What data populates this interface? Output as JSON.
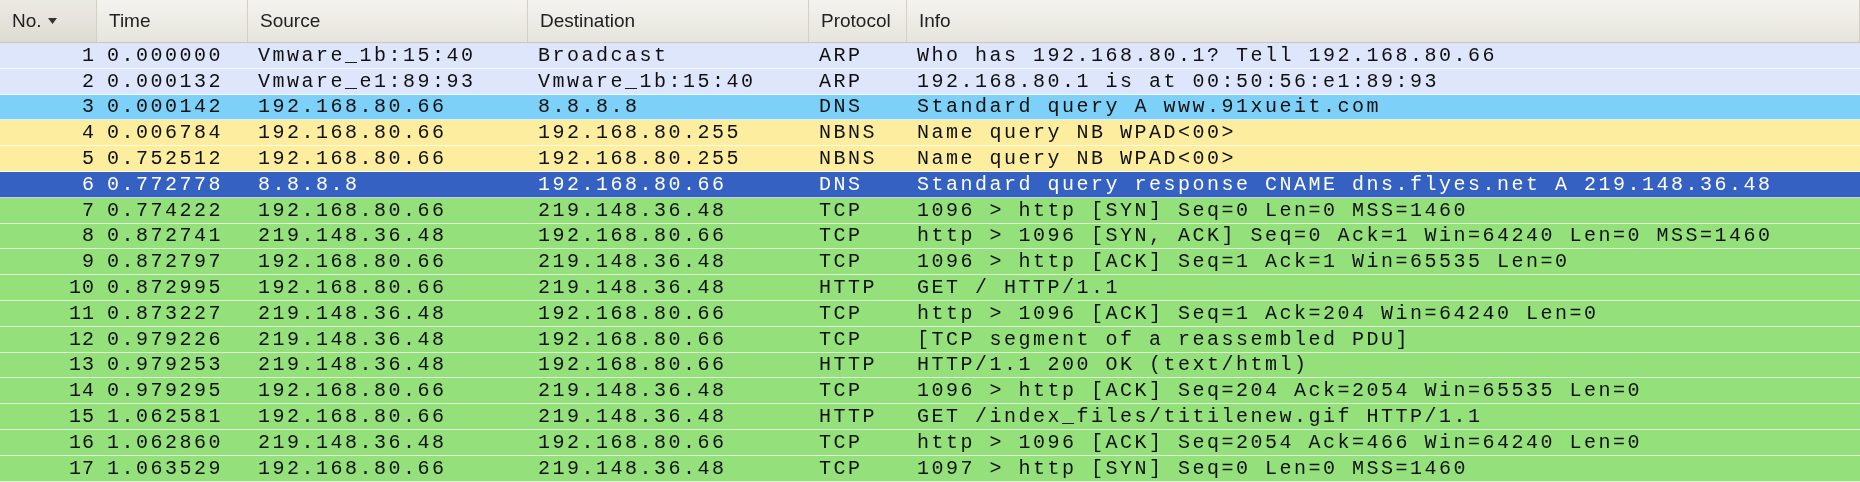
{
  "table": {
    "columns": [
      {
        "label": "No.",
        "sorted": true
      },
      {
        "label": "Time",
        "sorted": false
      },
      {
        "label": "Source",
        "sorted": false
      },
      {
        "label": "Destination",
        "sorted": false
      },
      {
        "label": "Protocol",
        "sorted": false
      },
      {
        "label": "Info",
        "sorted": false
      }
    ],
    "rows": [
      {
        "no": "1",
        "time": "0.000000",
        "source": "Vmware_1b:15:40",
        "destination": "Broadcast",
        "protocol": "ARP",
        "info": "Who has 192.168.80.1?  Tell 192.168.80.66",
        "color": "#dde6fb",
        "selected": false
      },
      {
        "no": "2",
        "time": "0.000132",
        "source": "Vmware_e1:89:93",
        "destination": "Vmware_1b:15:40",
        "protocol": "ARP",
        "info": "192.168.80.1 is at 00:50:56:e1:89:93",
        "color": "#dde6fb",
        "selected": false
      },
      {
        "no": "3",
        "time": "0.000142",
        "source": "192.168.80.66",
        "destination": "8.8.8.8",
        "protocol": "DNS",
        "info": "Standard query A www.91xueit.com",
        "color": "#7dd0f7",
        "selected": false
      },
      {
        "no": "4",
        "time": "0.006784",
        "source": "192.168.80.66",
        "destination": "192.168.80.255",
        "protocol": "NBNS",
        "info": "Name query NB WPAD<00>",
        "color": "#fdee9f",
        "selected": false
      },
      {
        "no": "5",
        "time": "0.752512",
        "source": "192.168.80.66",
        "destination": "192.168.80.255",
        "protocol": "NBNS",
        "info": "Name query NB WPAD<00>",
        "color": "#fdee9f",
        "selected": false
      },
      {
        "no": "6",
        "time": "0.772778",
        "source": "8.8.8.8",
        "destination": "192.168.80.66",
        "protocol": "DNS",
        "info": "Standard query response CNAME dns.flyes.net A 219.148.36.48",
        "selected": true
      },
      {
        "no": "7",
        "time": "0.774222",
        "source": "192.168.80.66",
        "destination": "219.148.36.48",
        "protocol": "TCP",
        "info": "1096 > http [SYN] Seq=0 Len=0 MSS=1460",
        "color": "#94e07a",
        "selected": false
      },
      {
        "no": "8",
        "time": "0.872741",
        "source": "219.148.36.48",
        "destination": "192.168.80.66",
        "protocol": "TCP",
        "info": "http > 1096 [SYN, ACK] Seq=0 Ack=1 Win=64240 Len=0 MSS=1460",
        "color": "#94e07a",
        "selected": false
      },
      {
        "no": "9",
        "time": "0.872797",
        "source": "192.168.80.66",
        "destination": "219.148.36.48",
        "protocol": "TCP",
        "info": "1096 > http [ACK] Seq=1 Ack=1 Win=65535 Len=0",
        "color": "#94e07a",
        "selected": false
      },
      {
        "no": "10",
        "time": "0.872995",
        "source": "192.168.80.66",
        "destination": "219.148.36.48",
        "protocol": "HTTP",
        "info": "GET / HTTP/1.1",
        "color": "#94e07a",
        "selected": false
      },
      {
        "no": "11",
        "time": "0.873227",
        "source": "219.148.36.48",
        "destination": "192.168.80.66",
        "protocol": "TCP",
        "info": "http > 1096 [ACK] Seq=1 Ack=204 Win=64240 Len=0",
        "color": "#94e07a",
        "selected": false
      },
      {
        "no": "12",
        "time": "0.979226",
        "source": "219.148.36.48",
        "destination": "192.168.80.66",
        "protocol": "TCP",
        "info": "[TCP segment of a reassembled PDU]",
        "color": "#94e07a",
        "selected": false
      },
      {
        "no": "13",
        "time": "0.979253",
        "source": "219.148.36.48",
        "destination": "192.168.80.66",
        "protocol": "HTTP",
        "info": "HTTP/1.1 200 OK (text/html)",
        "color": "#94e07a",
        "selected": false
      },
      {
        "no": "14",
        "time": "0.979295",
        "source": "192.168.80.66",
        "destination": "219.148.36.48",
        "protocol": "TCP",
        "info": "1096 > http [ACK] Seq=204 Ack=2054 Win=65535 Len=0",
        "color": "#94e07a",
        "selected": false
      },
      {
        "no": "15",
        "time": "1.062581",
        "source": "192.168.80.66",
        "destination": "219.148.36.48",
        "protocol": "HTTP",
        "info": "GET /index_files/titilenew.gif HTTP/1.1",
        "color": "#94e07a",
        "selected": false
      },
      {
        "no": "16",
        "time": "1.062860",
        "source": "219.148.36.48",
        "destination": "192.168.80.66",
        "protocol": "TCP",
        "info": "http > 1096 [ACK] Seq=2054 Ack=466 Win=64240 Len=0",
        "color": "#94e07a",
        "selected": false
      },
      {
        "no": "17",
        "time": "1.063529",
        "source": "192.168.80.66",
        "destination": "219.148.36.48",
        "protocol": "TCP",
        "info": "1097 > http [SYN] Seq=0 Len=0 MSS=1460",
        "color": "#94e07a",
        "selected": false
      }
    ]
  }
}
